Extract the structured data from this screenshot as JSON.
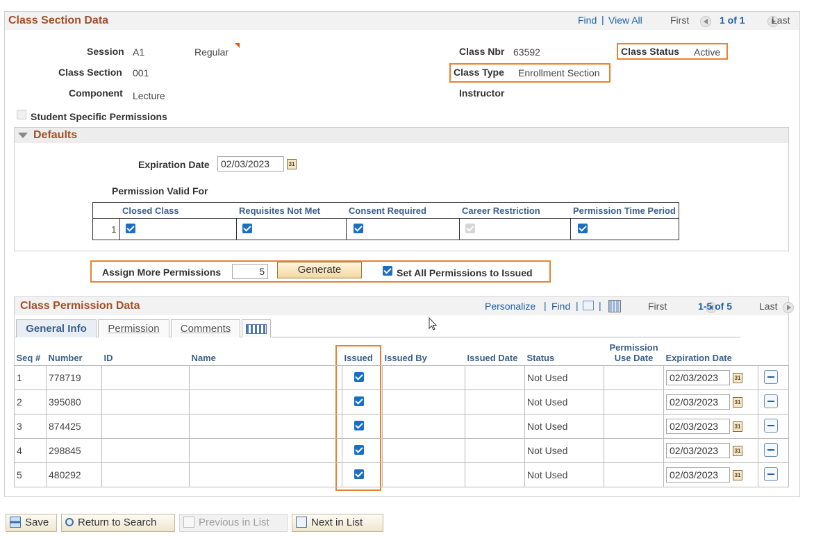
{
  "class_section": {
    "title": "Class Section Data",
    "nav": {
      "find": "Find",
      "view_all": "View All",
      "first": "First",
      "count": "1 of 1",
      "last": "Last"
    },
    "session_label": "Session",
    "session_value": "A1",
    "session_type": "Regular",
    "class_nbr_label": "Class Nbr",
    "class_nbr_value": "63592",
    "class_status_label": "Class Status",
    "class_status_value": "Active",
    "class_section_label": "Class Section",
    "class_section_value": "001",
    "class_type_label": "Class Type",
    "class_type_value": "Enrollment Section",
    "component_label": "Component",
    "component_value": "Lecture",
    "instructor_label": "Instructor",
    "student_specific_label": "Student Specific Permissions"
  },
  "defaults": {
    "title": "Defaults",
    "expiration_label": "Expiration Date",
    "expiration_value": "02/03/2023",
    "permission_valid_label": "Permission Valid For",
    "columns": [
      "Closed Class",
      "Requisites Not Met",
      "Consent Required",
      "Career Restriction",
      "Permission Time Period"
    ],
    "row_num": "1",
    "calendar_icon_text": "31"
  },
  "assign": {
    "label": "Assign More Permissions",
    "value": "5",
    "generate_label": "Generate",
    "set_all_label": "Set All Permissions to Issued"
  },
  "permission_data": {
    "title": "Class Permission Data",
    "nav": {
      "personalize": "Personalize",
      "find": "Find",
      "first": "First",
      "count": "1-5 of 5",
      "last": "Last"
    },
    "tabs": [
      "General Info",
      "Permission",
      "Comments"
    ],
    "headers": {
      "seq": "Seq #",
      "number": "Number",
      "id": "ID",
      "name": "Name",
      "issued": "Issued",
      "issued_by": "Issued By",
      "issued_date": "Issued Date",
      "status": "Status",
      "use_date": "Permission Use Date",
      "expiration": "Expiration Date"
    },
    "rows": [
      {
        "seq": "1",
        "number": "778719",
        "status": "Not Used",
        "expiration": "02/03/2023"
      },
      {
        "seq": "2",
        "number": "395080",
        "status": "Not Used",
        "expiration": "02/03/2023"
      },
      {
        "seq": "3",
        "number": "874425",
        "status": "Not Used",
        "expiration": "02/03/2023"
      },
      {
        "seq": "4",
        "number": "298845",
        "status": "Not Used",
        "expiration": "02/03/2023"
      },
      {
        "seq": "5",
        "number": "480292",
        "status": "Not Used",
        "expiration": "02/03/2023"
      }
    ]
  },
  "toolbar": {
    "save": "Save",
    "return": "Return to Search",
    "previous": "Previous in List",
    "next": "Next in List"
  },
  "colors": {
    "highlight": "#e8822f",
    "title": "#a0502a",
    "link": "#1a5fa8",
    "checkbox": "#1a6fc4"
  }
}
